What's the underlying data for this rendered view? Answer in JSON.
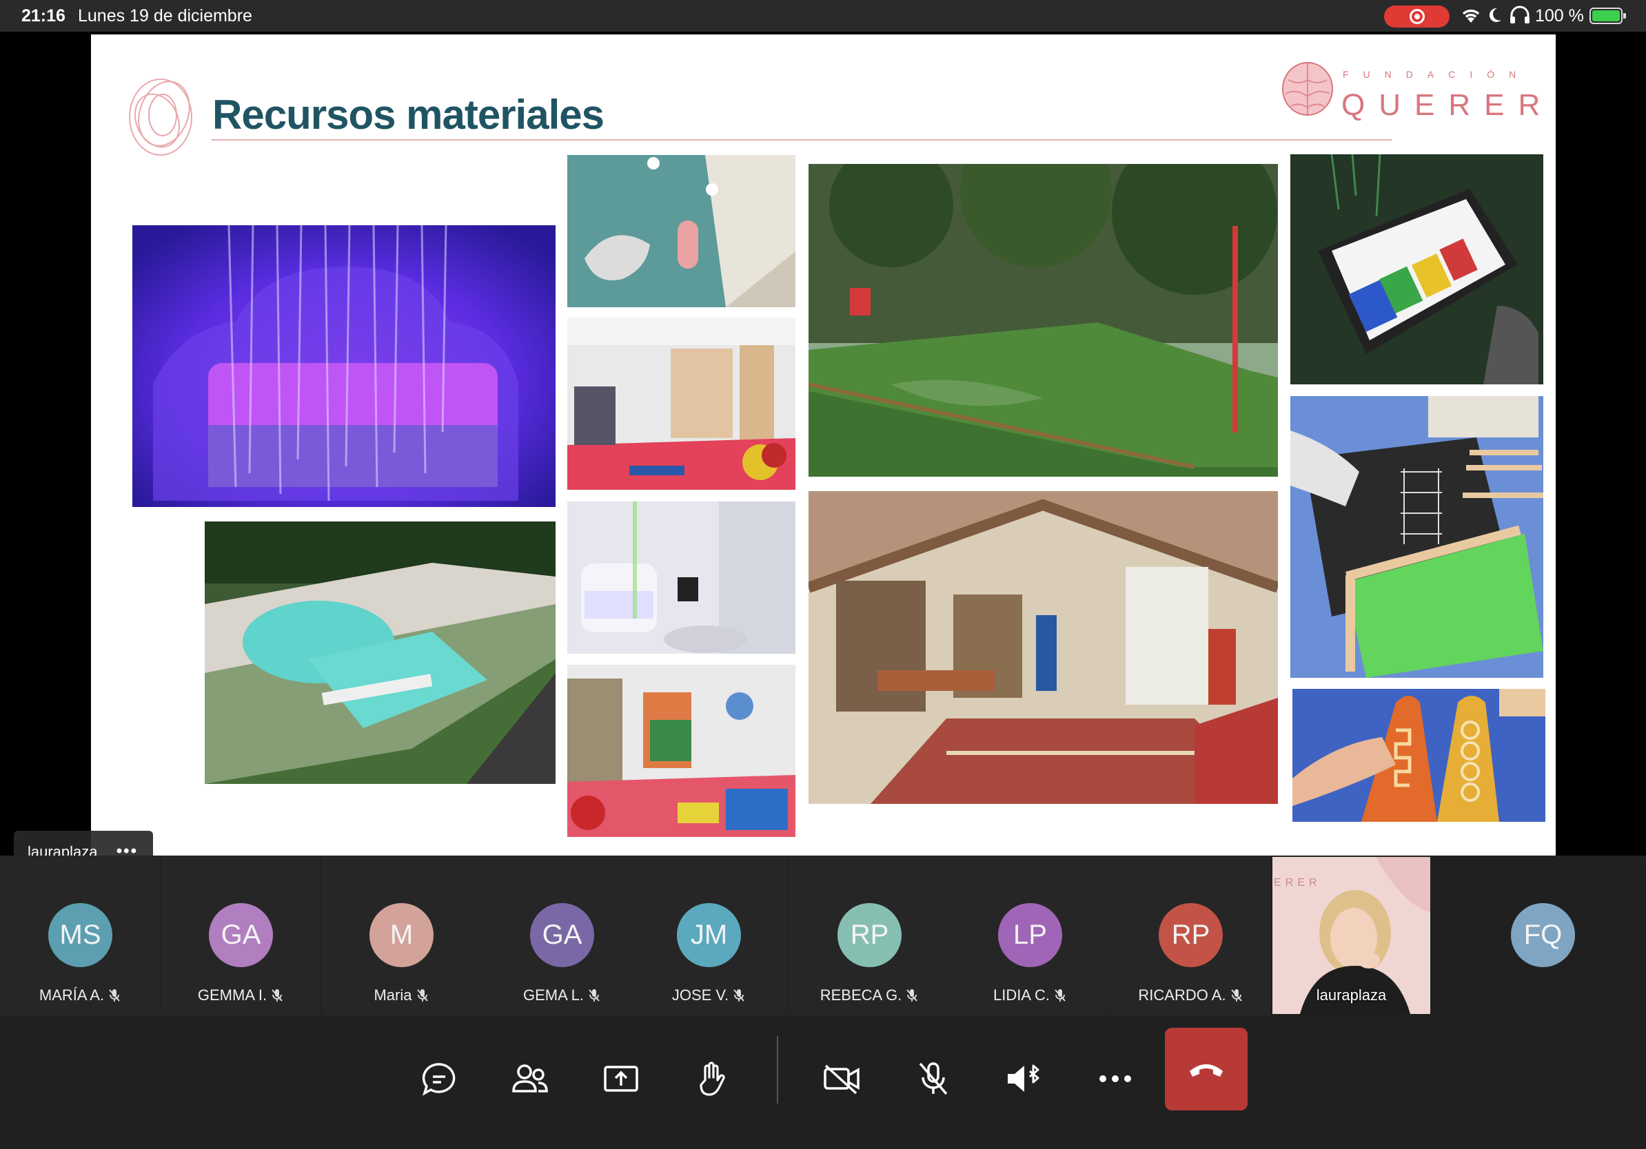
{
  "status_bar": {
    "time": "21:16",
    "date": "Lunes 19 de diciembre",
    "battery": "100 %"
  },
  "slide": {
    "title": "Recursos materiales",
    "logo_top": "FUNDACIÓN",
    "logo_main": "QUERER"
  },
  "presenter_tag": {
    "name": "lauraplaza",
    "more": "•••"
  },
  "participants": [
    {
      "initials": "MS",
      "name": "MARÍA A.",
      "color": "#5b9fb0"
    },
    {
      "initials": "GA",
      "name": "GEMMA I.",
      "color": "#b17fc0"
    },
    {
      "initials": "M",
      "name": "Maria",
      "color": "#d3a39a"
    },
    {
      "initials": "GA",
      "name": "GEMA L.",
      "color": "#7a68a6"
    },
    {
      "initials": "JM",
      "name": "JOSE V.",
      "color": "#5aa9bf"
    },
    {
      "initials": "RP",
      "name": "REBECA G.",
      "color": "#86bfb2"
    },
    {
      "initials": "LP",
      "name": "LIDIA C.",
      "color": "#a165b8"
    },
    {
      "initials": "RP",
      "name": "RICARDO A.",
      "color": "#c25346"
    }
  ],
  "self_video": {
    "name": "lauraplaza",
    "backdrop_text": "ERER"
  },
  "extra_participant": {
    "initials": "FQ",
    "color": "#7fa5c2"
  },
  "colors": {
    "hangup": "#b73a37",
    "title": "#1f5463",
    "brand": "#d9757f"
  }
}
